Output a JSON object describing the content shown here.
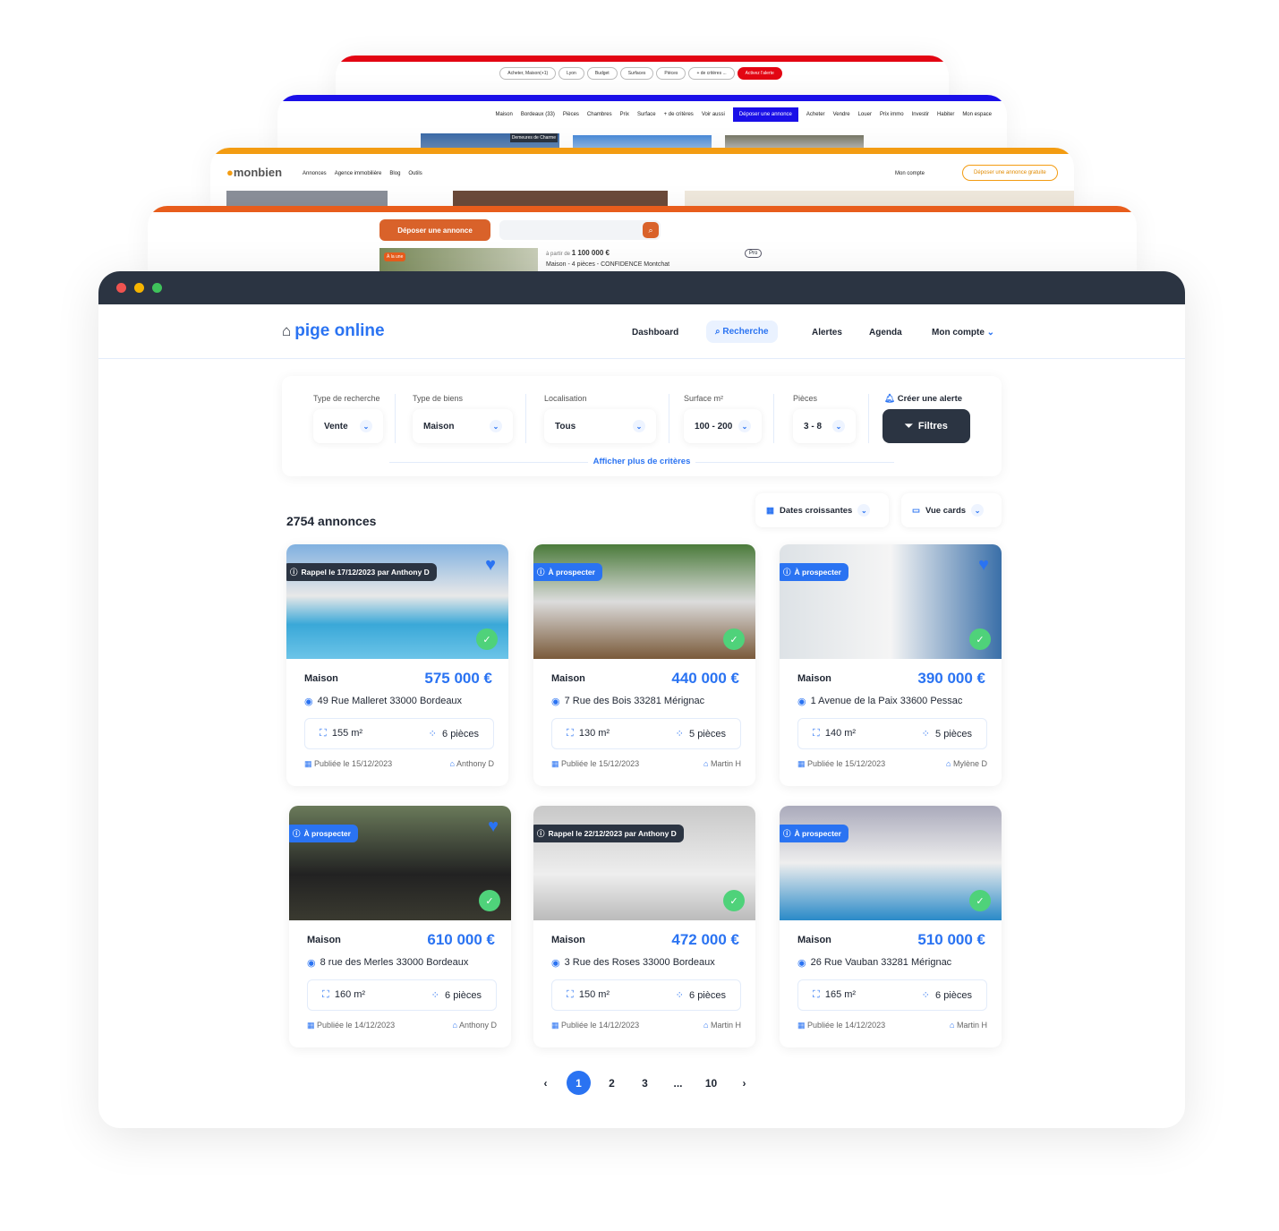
{
  "bg_windows": {
    "red": {
      "color": "#e30613",
      "chips": [
        "Acheter, Maison(+1)",
        "Lyon",
        "Budget",
        "Surfaces",
        "Pièces",
        "+ de critères ..."
      ],
      "alert_button": "Activez l'alerte"
    },
    "blue": {
      "color": "#1a0fe8",
      "filters": [
        "Maison",
        "Bordeaux (33)",
        "Pièces",
        "Chambres",
        "Prix",
        "Surface",
        "+ de critères",
        "Voir aussi"
      ],
      "cta": "Déposer une annonce",
      "links": [
        "Acheter",
        "Vendre",
        "Louer",
        "Prix immo",
        "Investir",
        "Habiter",
        "Mon espace"
      ],
      "badge": "Demeures de Charme"
    },
    "orange": {
      "color": "#f39c12",
      "logo": "monbien",
      "menu": [
        "Annonces",
        "Agence immobilière",
        "Blog",
        "Outils"
      ],
      "account": "Mon compte",
      "cta": "Déposer une annonce gratuite"
    },
    "darkorange": {
      "color": "#e85d1c",
      "cta": "Déposer une annonce",
      "badge": "À la une",
      "price_prefix": "à partir de",
      "price": "1 100 000 €",
      "title": "Maison - 4 pièces - CONFIDENCE Montchat",
      "pro": "Pro"
    }
  },
  "app": {
    "logo": "pige online",
    "nav": [
      "Dashboard",
      "Recherche",
      "Alertes",
      "Agenda",
      "Mon compte"
    ],
    "active_nav": "Recherche",
    "filters": [
      {
        "label": "Type de recherche",
        "value": "Vente"
      },
      {
        "label": "Type de biens",
        "value": "Maison"
      },
      {
        "label": "Localisation",
        "value": "Tous"
      },
      {
        "label": "Surface m²",
        "value": "100 - 200"
      },
      {
        "label": "Pièces",
        "value": "3 - 8"
      }
    ],
    "create_alert": "Créer une alerte",
    "filters_button": "Filtres",
    "more_criteria": "Afficher plus de critères",
    "count": "2754 annonces",
    "sort": "Dates croissantes",
    "view": "Vue cards",
    "accent": "#2a73f2",
    "cards": [
      {
        "tag": "Rappel le 17/12/2023 par Anthony D",
        "tag_dark": true,
        "fav": true,
        "type": "Maison",
        "price": "575 000 €",
        "address": "49 Rue Malleret 33000 Bordeaux",
        "surface": "155 m²",
        "rooms": "6 pièces",
        "published": "Publiée le 15/12/2023",
        "agent": "Anthony D"
      },
      {
        "tag": "À prospecter",
        "tag_dark": false,
        "fav": false,
        "type": "Maison",
        "price": "440 000 €",
        "address": "7 Rue des Bois 33281 Mérignac",
        "surface": "130 m²",
        "rooms": "5 pièces",
        "published": "Publiée le 15/12/2023",
        "agent": "Martin H"
      },
      {
        "tag": "À prospecter",
        "tag_dark": false,
        "fav": true,
        "type": "Maison",
        "price": "390 000 €",
        "address": "1 Avenue de la Paix 33600 Pessac",
        "surface": "140 m²",
        "rooms": "5 pièces",
        "published": "Publiée le 15/12/2023",
        "agent": "Mylène D"
      },
      {
        "tag": "À prospecter",
        "tag_dark": false,
        "fav": true,
        "type": "Maison",
        "price": "610 000 €",
        "address": "8 rue des Merles 33000 Bordeaux",
        "surface": "160 m²",
        "rooms": "6 pièces",
        "published": "Publiée le 14/12/2023",
        "agent": "Anthony D"
      },
      {
        "tag": "Rappel le 22/12/2023 par Anthony D",
        "tag_dark": true,
        "fav": false,
        "type": "Maison",
        "price": "472 000 €",
        "address": "3 Rue des Roses 33000 Bordeaux",
        "surface": "150 m²",
        "rooms": "6 pièces",
        "published": "Publiée le 14/12/2023",
        "agent": "Martin H"
      },
      {
        "tag": "À prospecter",
        "tag_dark": false,
        "fav": false,
        "type": "Maison",
        "price": "510 000 €",
        "address": "26 Rue Vauban 33281 Mérignac",
        "surface": "165 m²",
        "rooms": "6 pièces",
        "published": "Publiée le 14/12/2023",
        "agent": "Martin H"
      }
    ],
    "pagination": {
      "pages": [
        "1",
        "2",
        "3",
        "...",
        "10"
      ],
      "current": "1"
    }
  }
}
